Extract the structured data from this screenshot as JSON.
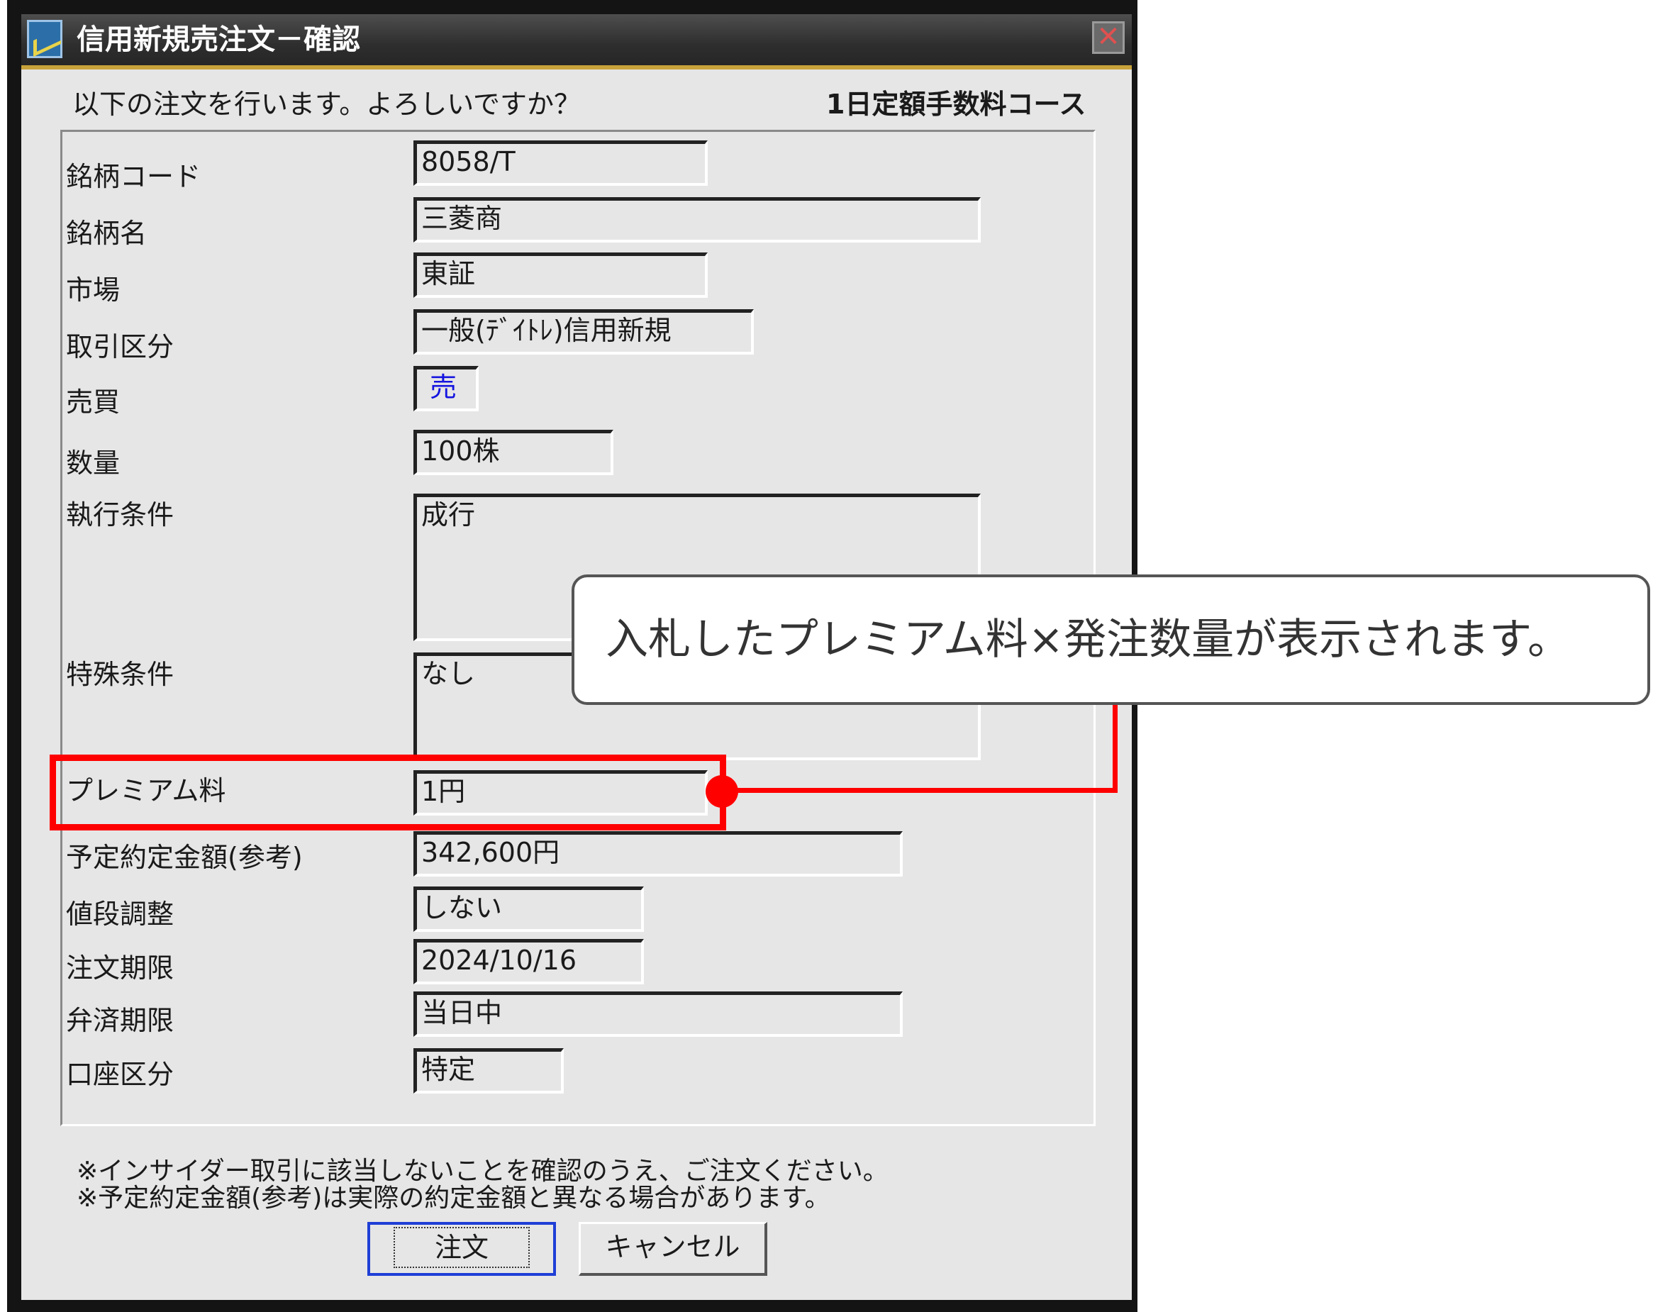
{
  "window": {
    "title": "信用新規売注文－確認",
    "close_glyph": "✕"
  },
  "header": {
    "prompt": "以下の注文を行います。よろしいですか？",
    "course": "1日定額手数料コース"
  },
  "fields": {
    "code": {
      "label": "銘柄コード",
      "value": "8058/T"
    },
    "name": {
      "label": "銘柄名",
      "value": "三菱商"
    },
    "market": {
      "label": "市場",
      "value": "東証"
    },
    "trade_type": {
      "label": "取引区分",
      "value": "一般(ﾃﾞｲﾄﾚ)信用新規"
    },
    "side": {
      "label": "売買",
      "value": "売"
    },
    "quantity": {
      "label": "数量",
      "value": "100株"
    },
    "execution": {
      "label": "執行条件",
      "value": "成行"
    },
    "special": {
      "label": "特殊条件",
      "value": "なし"
    },
    "premium": {
      "label": "プレミアム料",
      "value": "1円"
    },
    "amount": {
      "label": "予定約定金額(参考)",
      "value": "342,600円"
    },
    "price_adjust": {
      "label": "値段調整",
      "value": "しない"
    },
    "order_expiry": {
      "label": "注文期限",
      "value": "2024/10/16"
    },
    "settle_expiry": {
      "label": "弁済期限",
      "value": "当日中"
    },
    "account": {
      "label": "口座区分",
      "value": "特定"
    }
  },
  "notes": [
    "※インサイダー取引に該当しないことを確認のうえ、ご注文ください。",
    "※予定約定金額(参考)は実際の約定金額と異なる場合があります。"
  ],
  "buttons": {
    "order": "注文",
    "cancel": "キャンセル"
  },
  "annotation": {
    "text": "入札したプレミアム料×発注数量が表示されます。",
    "highlight_color": "#ff0000"
  },
  "colors": {
    "sell_text": "#1515e0",
    "default_button_border": "#1f3fd6",
    "title_accent": "#c8a23a"
  }
}
